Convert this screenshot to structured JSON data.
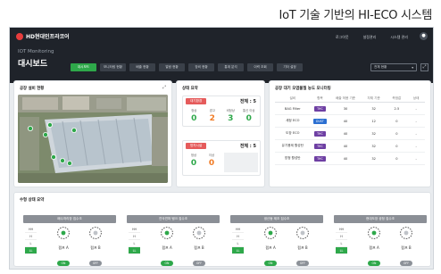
{
  "caption": "IoT 기술 기반의 HI-ECO 시스템",
  "header": {
    "brand": "HD현대인프라코어",
    "links": [
      "로그아웃",
      "설정관리",
      "시스템 관리"
    ],
    "user_icon": "user-icon",
    "subtitle": "IOT Monitoring",
    "title": "대시보드",
    "tabs": [
      "대시보드",
      "모니터링 현황",
      "배출 현황",
      "알람 현황",
      "장비 현황",
      "통계 분석",
      "이력 조회",
      "기타 설정"
    ],
    "active_tab": 0,
    "select_value": "전체 현황"
  },
  "map_panel": {
    "title": "공장 설비 현황"
  },
  "status_panel": {
    "title": "상태 요약",
    "cards": [
      {
        "pill": "대기환경",
        "total_label": "전체 : 5",
        "items": [
          {
            "label": "정상",
            "value": "0",
            "color": "#2ea84a"
          },
          {
            "label": "경고",
            "value": "2",
            "color": "#f07b25"
          },
          {
            "label": "비정상",
            "value": "3",
            "color": "#2ea84a"
          },
          {
            "label": "통신 이상",
            "value": "0",
            "color": "#2ea84a"
          }
        ]
      },
      {
        "pill": "방지시설",
        "total_label": "전체 : 5",
        "items": [
          {
            "label": "정상",
            "value": "0",
            "color": "#2ea84a"
          },
          {
            "label": "이상",
            "value": "0",
            "color": "#f07b25"
          }
        ]
      }
    ]
  },
  "table_panel": {
    "title": "공장 대기 오염물질 농도 모니터링",
    "columns": [
      "설비",
      "항목",
      "배출 허용 기준",
      "자체 기준",
      "측정값",
      "상태"
    ],
    "rows": [
      {
        "name": "BAG Filter",
        "tag": "THC",
        "limit": "30",
        "own": "32",
        "measure": "2.5",
        "status": "-"
      },
      {
        "name": "세정 ECO",
        "tag": "DUST",
        "limit": "40",
        "own": "12",
        "measure": "0",
        "status": "-"
      },
      {
        "name": "도장 ECO",
        "tag": "THC",
        "limit": "40",
        "own": "32",
        "measure": "0",
        "status": "-"
      },
      {
        "name": "유기용제 활성탄",
        "tag": "THC",
        "limit": "40",
        "own": "32",
        "measure": "0",
        "status": "-"
      },
      {
        "name": "방청 활성탄",
        "tag": "THC",
        "limit": "40",
        "own": "32",
        "measure": "0",
        "status": "-"
      }
    ]
  },
  "pump_panel": {
    "title": "수형 상태 요약",
    "levels": [
      "HH",
      "H",
      "L",
      "LL"
    ],
    "blocks": [
      {
        "title": "폐수처리장 집수조",
        "active_level": "LL",
        "pumps": [
          {
            "name": "펌프 A",
            "state": "ON"
          },
          {
            "name": "펌프 B",
            "state": "OFF"
          }
        ]
      },
      {
        "title": "연삭연마 탱크 집수조",
        "active_level": "LL",
        "pumps": [
          {
            "name": "펌프 A",
            "state": "ON"
          },
          {
            "name": "펌프 B",
            "state": "OFF"
          }
        ]
      },
      {
        "title": "생산동 제조 집수조",
        "active_level": "LL",
        "pumps": [
          {
            "name": "펌프 A",
            "state": "ON"
          },
          {
            "name": "펌프 B",
            "state": "OFF"
          }
        ]
      },
      {
        "title": "현대도장 공정 집수조",
        "active_level": "LL",
        "pumps": [
          {
            "name": "펌프 A",
            "state": "ON"
          },
          {
            "name": "펌프 B",
            "state": "OFF"
          }
        ]
      }
    ]
  },
  "colors": {
    "accent": "#2ea84a",
    "warning": "#f07b25",
    "header": "#1f232a",
    "thc_tag": "#6e3fa3",
    "dust_tag": "#2b6fd1"
  }
}
